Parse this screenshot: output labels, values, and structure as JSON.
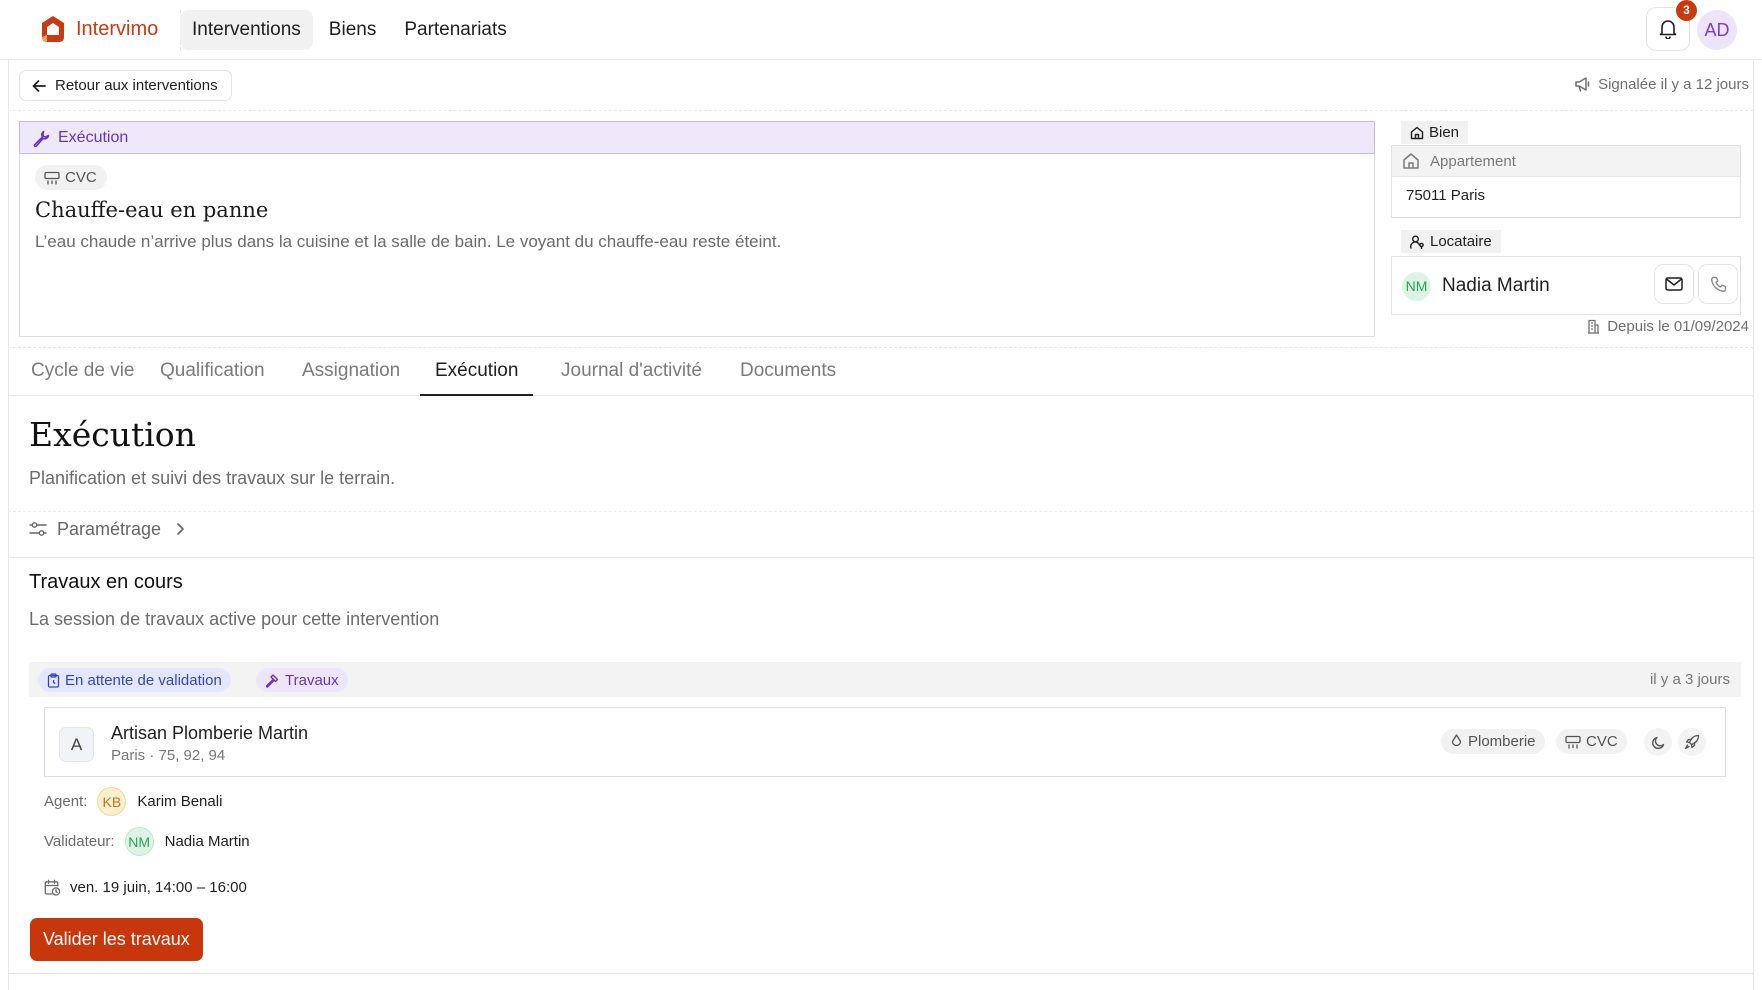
{
  "app": {
    "name": "Intervimo",
    "brand_color": "#c93a10"
  },
  "nav": {
    "items": [
      "Interventions",
      "Biens",
      "Partenariats"
    ],
    "active": 0
  },
  "header": {
    "notifications_count": "3",
    "user_initials": "AD"
  },
  "back": {
    "label": "Retour aux interventions"
  },
  "reported": {
    "text": "Signalée il y a 12 jours"
  },
  "intervention": {
    "stage": "Exécution",
    "category": "CVC",
    "title": "Chauffe-eau en panne",
    "description": "L’eau chaude n’arrive plus dans la cuisine et la salle de bain. Le voyant du chauffe-eau reste éteint."
  },
  "property": {
    "tab_label": "Bien",
    "type": "Appartement",
    "address": "75011 Paris"
  },
  "tenant": {
    "tab_label": "Locataire",
    "initials": "NM",
    "name": "Nadia Martin",
    "since": "Depuis le 01/09/2024"
  },
  "tabs": [
    "Cycle de vie",
    "Qualification",
    "Assignation",
    "Exécution",
    "Journal d'activité",
    "Documents"
  ],
  "active_tab": 3,
  "section": {
    "title": "Exécution",
    "subtitle": "Planification et suivi des travaux sur le terrain.",
    "settings_label": "Paramétrage"
  },
  "works": {
    "title": "Travaux en cours",
    "subtitle": "La session de travaux active pour cette intervention",
    "status": "En attente de validation",
    "type": "Travaux",
    "time": "il y a 3 jours",
    "artisan": {
      "initial": "A",
      "name": "Artisan Plomberie Martin",
      "zone": "Paris · 75, 92, 94",
      "specialties": [
        "Plomberie",
        "CVC"
      ]
    },
    "agent": {
      "label": "Agent:",
      "initials": "KB",
      "name": "Karim Benali"
    },
    "validator": {
      "label": "Validateur:",
      "initials": "NM",
      "name": "Nadia Martin"
    },
    "schedule": "ven. 19 juin, 14:00 – 16:00",
    "validate_label": "Valider les travaux"
  }
}
